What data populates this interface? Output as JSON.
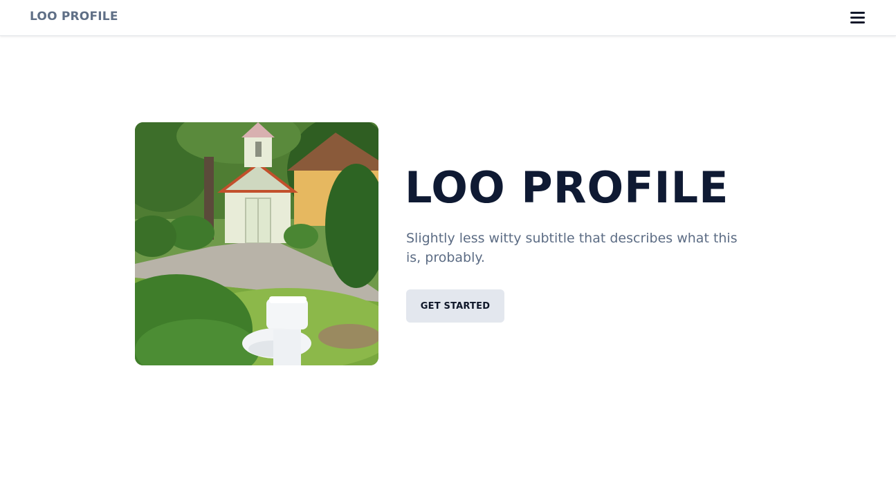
{
  "header": {
    "brand": "LOO PROFILE",
    "menu_icon": "hamburger-menu-icon"
  },
  "hero": {
    "image_alt": "Outdoor toilet on a lawn in front of a small church",
    "title": "LOO PROFILE",
    "subtitle": "Slightly less witty subtitle that describes what this is, probably.",
    "cta_label": "GET STARTED"
  },
  "colors": {
    "brand_text": "#5f6f86",
    "title_text": "#0f1a33",
    "subtitle_text": "#5c6c84",
    "button_bg": "#e3e7ee",
    "button_text": "#0f1729"
  }
}
